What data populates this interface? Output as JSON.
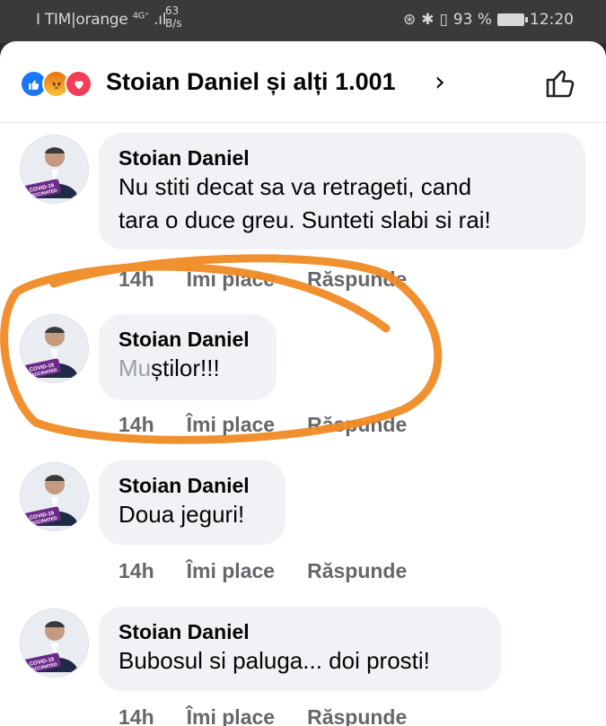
{
  "status_bar": {
    "carrier": "I TIM|orange",
    "signal_label": "4G⁺",
    "speed_value": "63",
    "speed_unit": "B/s",
    "battery_percent": "93 %",
    "time": "12:20"
  },
  "header": {
    "likers": "Stoian Daniel și alți 1.001",
    "chevron": "›",
    "reaction_icons": [
      "like-icon",
      "angry-icon",
      "love-icon"
    ]
  },
  "avatar": {
    "badge_line1": "COVID-19",
    "badge_line2": "VACCINATED"
  },
  "comments": [
    {
      "author": "Stoian Daniel",
      "lines": [
        "Nu stiti decat sa va retrageti, cand",
        "tara o duce greu. Sunteti slabi si rai!"
      ],
      "time": "14h",
      "like": "Îmi place",
      "reply": "Răspunde"
    },
    {
      "author": "Stoian Daniel",
      "blurred_part": "Mu",
      "lines": [
        "știlor!!!"
      ],
      "time": "14h",
      "like": "Îmi place",
      "reply": "Răspunde"
    },
    {
      "author": "Stoian Daniel",
      "lines": [
        "Doua jeguri!"
      ],
      "time": "14h",
      "like": "Îmi place",
      "reply": "Răspunde"
    },
    {
      "author": "Stoian Daniel",
      "lines": [
        "Bubosul si paluga... doi prosti!"
      ],
      "time": "14h",
      "like": "Îmi place",
      "reply": "Răspunde"
    }
  ],
  "colors": {
    "accent_circle": "#f08a24",
    "bubble": "#f0f2f5",
    "meta_text": "#65676b"
  }
}
